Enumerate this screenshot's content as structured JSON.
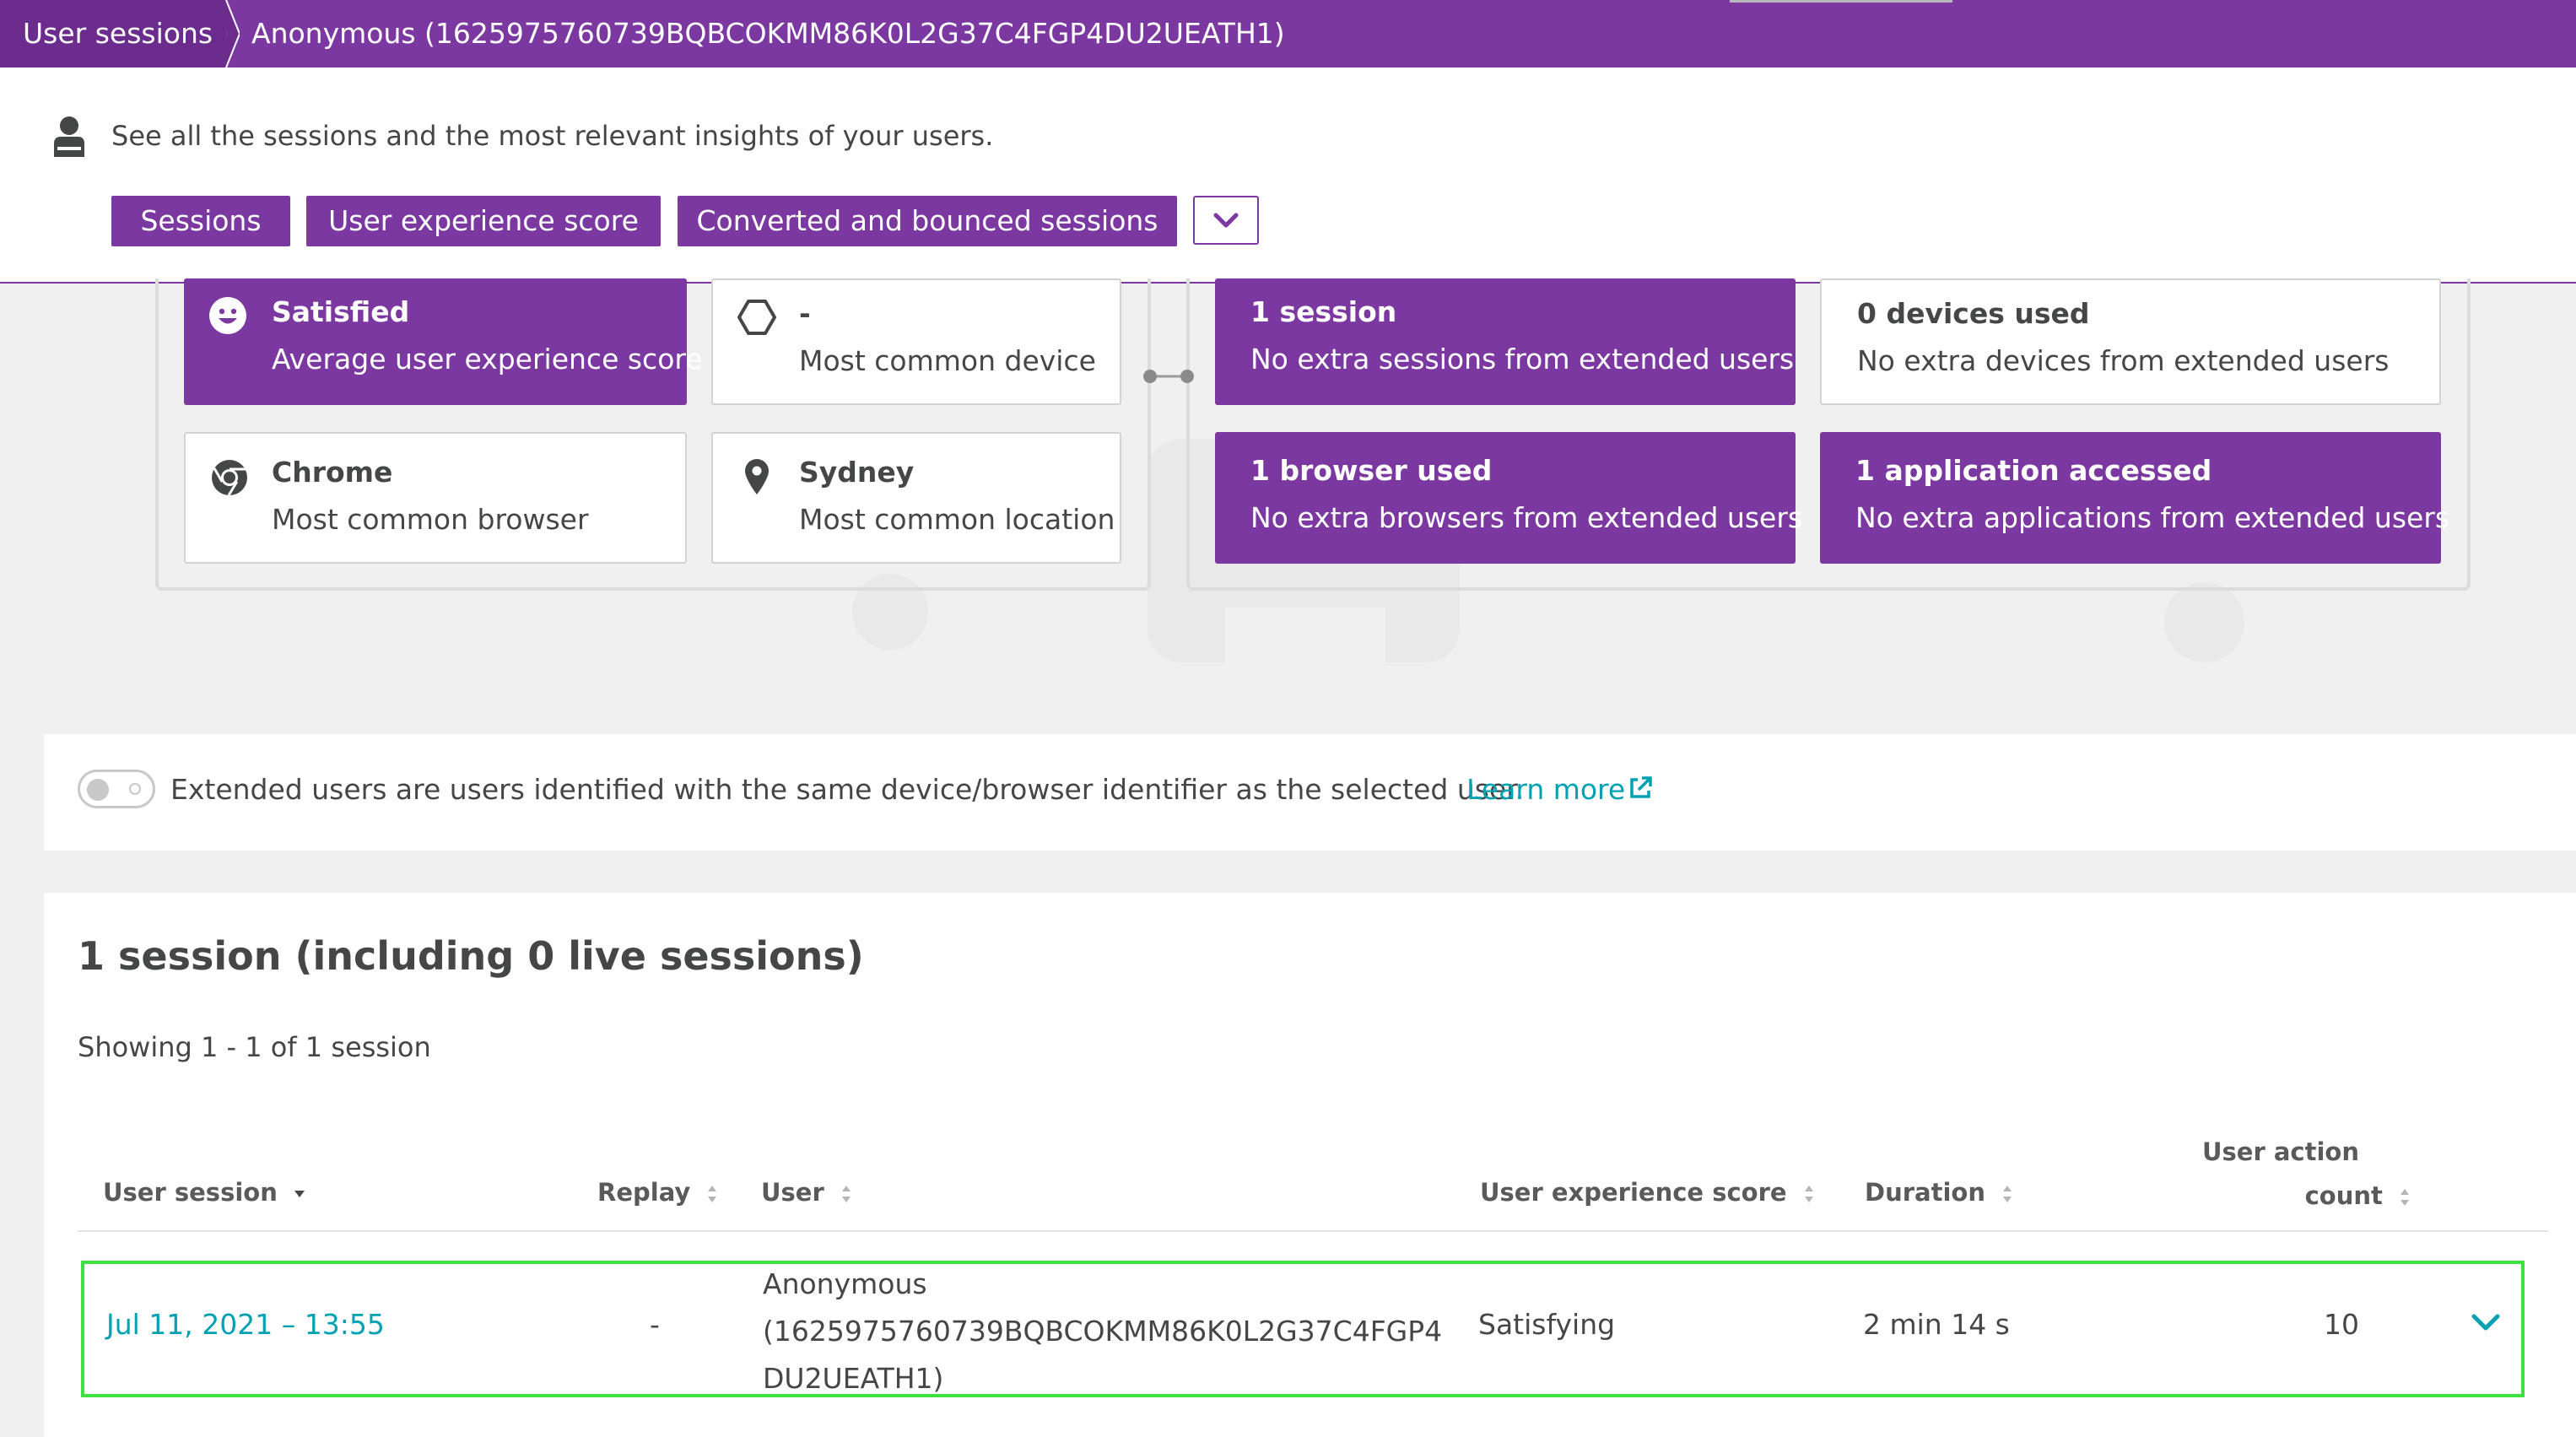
{
  "breadcrumb": {
    "root": "User sessions",
    "current": "Anonymous (1625975760739BQBCOKMM86K0L2G37C4FGP4DU2UEATH1)"
  },
  "header": {
    "icon": "user-icon",
    "description": "See all the sessions and the most relevant insights of your users.",
    "tabs": [
      "Sessions",
      "User experience score",
      "Converted and bounced sessions"
    ],
    "more_icon": "chevron-down-icon"
  },
  "overview": {
    "user_tiles": [
      {
        "title": "Satisfied",
        "subtitle": "Average user experience score",
        "icon": "smiley-icon"
      },
      {
        "title": "-",
        "subtitle": "Most common device",
        "icon": "hexagon-icon"
      },
      {
        "title": "Chrome",
        "subtitle": "Most common browser",
        "icon": "chrome-icon"
      },
      {
        "title": "Sydney",
        "subtitle": "Most common location",
        "icon": "location-pin-icon"
      }
    ],
    "extended_tiles": [
      {
        "title": "1 session",
        "subtitle": "No extra sessions from extended users"
      },
      {
        "title": "0 devices used",
        "subtitle": "No extra devices from extended users"
      },
      {
        "title": "1 browser used",
        "subtitle": "No extra browsers from extended users"
      },
      {
        "title": "1 application accessed",
        "subtitle": "No extra applications from extended users"
      }
    ]
  },
  "extended_users": {
    "toggle_on": false,
    "text": "Extended users are users identified with the same device/browser identifier as the selected user.",
    "learn_more": "Learn more"
  },
  "sessions": {
    "title": "1 session (including 0 live sessions)",
    "showing": "Showing 1 - 1 of 1 session",
    "columns": {
      "user_session": "User session",
      "replay": "Replay",
      "user": "User",
      "ux_score": "User experience score",
      "duration": "Duration",
      "action_count_line1": "User action",
      "action_count_line2": "count"
    },
    "rows": [
      {
        "date": "Jul 11, 2021  –  13:55",
        "replay": "-",
        "user_line1": "Anonymous",
        "user_line2": "(1625975760739BQBCOKMM86K0L2G37C4FGP4",
        "user_line3": "DU2UEATH1)",
        "ux_score": "Satisfying",
        "duration": "2 min 14 s",
        "action_count": "10"
      }
    ]
  },
  "colors": {
    "brand_purple": "#7c38a1",
    "link_teal": "#00a1b2",
    "highlight_green": "#3fe03f"
  }
}
